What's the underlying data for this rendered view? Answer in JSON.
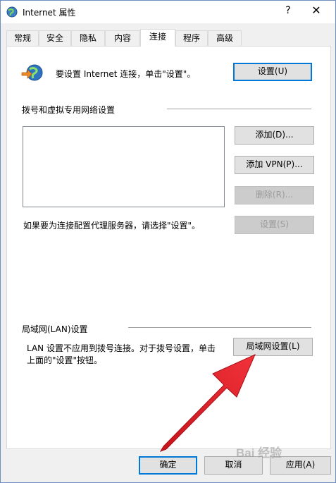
{
  "window": {
    "title": "Internet 属性",
    "help": "?",
    "close": "✕"
  },
  "tabs": [
    {
      "label": "常规"
    },
    {
      "label": "安全"
    },
    {
      "label": "隐私"
    },
    {
      "label": "内容"
    },
    {
      "label": "连接",
      "active": true
    },
    {
      "label": "程序"
    },
    {
      "label": "高级"
    }
  ],
  "setup": {
    "text": "要设置 Internet 连接，单击\"设置\"。",
    "button": "设置(U)"
  },
  "dialup": {
    "heading": "拨号和虚拟专用网络设置",
    "add_button": "添加(D)...",
    "add_vpn_button": "添加 VPN(P)...",
    "remove_button": "删除(R)...",
    "proxy_text": "如果要为连接配置代理服务器，请选择\"设置\"。",
    "settings_button": "设置(S)"
  },
  "lan": {
    "heading": "局域网(LAN)设置",
    "text_line1": "LAN 设置不应用到拨号连接。对于拨号设置，单击",
    "text_line2": "上面的\"设置\"按钮。",
    "button": "局域网设置(L)"
  },
  "footer": {
    "ok": "确定",
    "cancel": "取消",
    "apply": "应用(A)"
  },
  "overlay": {
    "watermark": "Bai 经验",
    "arrow_color": "#e8202a"
  }
}
